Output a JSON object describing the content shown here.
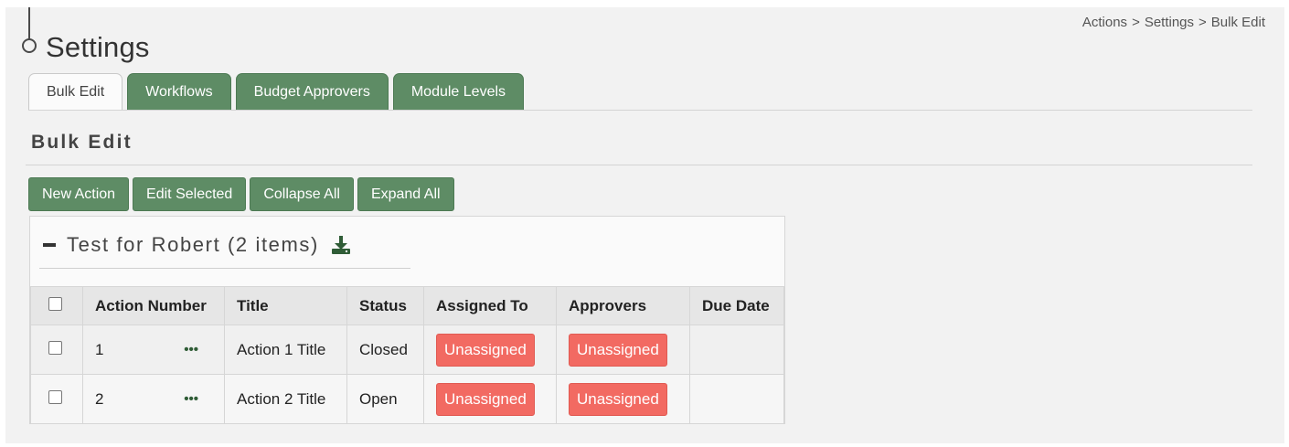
{
  "breadcrumb": {
    "items": [
      "Actions",
      "Settings",
      "Bulk Edit"
    ],
    "separator": ">"
  },
  "header": {
    "title": "Settings"
  },
  "tabs": [
    {
      "label": "Bulk Edit",
      "active": true
    },
    {
      "label": "Workflows",
      "active": false
    },
    {
      "label": "Budget Approvers",
      "active": false
    },
    {
      "label": "Module Levels",
      "active": false
    }
  ],
  "section": {
    "title": "Bulk Edit"
  },
  "toolbar": {
    "new_action": "New Action",
    "edit_selected": "Edit Selected",
    "collapse_all": "Collapse All",
    "expand_all": "Expand All"
  },
  "group": {
    "title": "Test for Robert (2 items)",
    "icons": {
      "collapse": "minus-icon",
      "download": "download-icon"
    }
  },
  "table": {
    "headers": [
      "Action Number",
      "Title",
      "Status",
      "Assigned To",
      "Approvers",
      "Due Date"
    ],
    "rows": [
      {
        "number": "1",
        "menu": "•••",
        "title": "Action 1 Title",
        "status": "Closed",
        "assigned_to": "Unassigned",
        "approvers": "Unassigned",
        "due_date": ""
      },
      {
        "number": "2",
        "menu": "•••",
        "title": "Action 2 Title",
        "status": "Open",
        "assigned_to": "Unassigned",
        "approvers": "Unassigned",
        "due_date": ""
      }
    ]
  },
  "colors": {
    "accent_green": "#5e8c65",
    "unassigned_red": "#f26a62"
  }
}
